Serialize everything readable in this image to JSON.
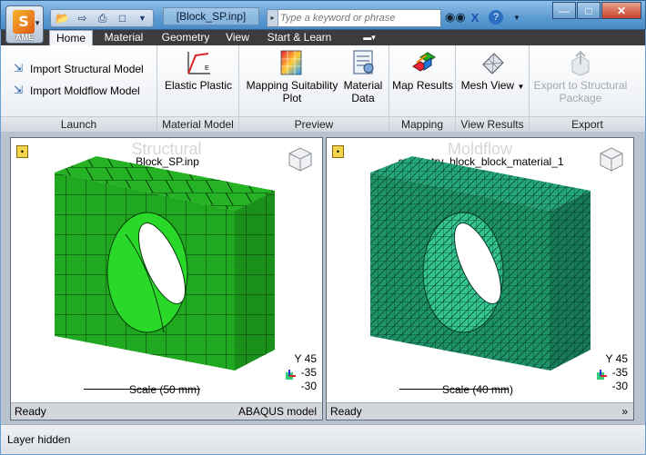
{
  "app": {
    "logo_letter": "S",
    "logo_text": "AME",
    "document_title": "[Block_SP.inp]"
  },
  "search": {
    "placeholder": "Type a keyword or phrase"
  },
  "tabs": [
    "Home",
    "Material",
    "Geometry",
    "View",
    "Start & Learn"
  ],
  "ribbon": {
    "launch": {
      "import_structural": "Import Structural Model",
      "import_moldflow": "Import Moldflow Model",
      "title": "Launch"
    },
    "material_model": {
      "elastic_plastic": "Elastic Plastic",
      "title": "Material Model"
    },
    "preview": {
      "mapping_suitability_line1": "Mapping Suitability",
      "mapping_suitability_line2": "Plot",
      "material_data_line1": "Material",
      "material_data_line2": "Data",
      "title": "Preview"
    },
    "mapping": {
      "map_results": "Map Results",
      "title": "Mapping"
    },
    "view_results": {
      "mesh_view": "Mesh View",
      "title": "View Results"
    },
    "export": {
      "export_line1": "Export to Structural",
      "export_line2": "Package",
      "title": "Export"
    }
  },
  "viewports": [
    {
      "title": "Structural",
      "file": "Block_SP.inp",
      "axis_y": "Y 45",
      "axis_2": "-35",
      "axis_3": "-30",
      "scale": "Scale (50 mm)",
      "status": "Ready",
      "status_right": "ABAQUS model",
      "mesh_color": "#1fa51f"
    },
    {
      "title": "Moldflow",
      "file": "geometry_block_block_material_1",
      "axis_y": "Y 45",
      "axis_2": "-35",
      "axis_3": "-30",
      "scale": "Scale (40 mm)",
      "status": "Ready",
      "status_right": "»",
      "mesh_color": "#1f8f6a"
    }
  ],
  "statusbar": {
    "text": "Layer hidden"
  }
}
